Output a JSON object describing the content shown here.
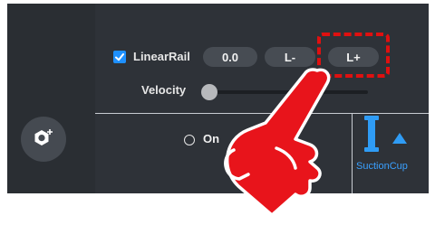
{
  "linear_rail": {
    "label": "LinearRail",
    "checked": true,
    "value": "0.0",
    "minus_label": "L-",
    "plus_label": "L+"
  },
  "velocity": {
    "label": "Velocity",
    "level": 0
  },
  "suction": {
    "on_label": "On",
    "tool_label": "SuctionCup"
  },
  "icons": {
    "gear": "gear-plus-icon",
    "check": "check-icon",
    "suction": "suction-cup-icon",
    "arrow": "triangle-up-icon",
    "hand": "pointing-hand-icon"
  },
  "colors": {
    "panel": "#2e3238",
    "accent_blue": "#1e90ff",
    "highlight_red": "#e01010"
  }
}
